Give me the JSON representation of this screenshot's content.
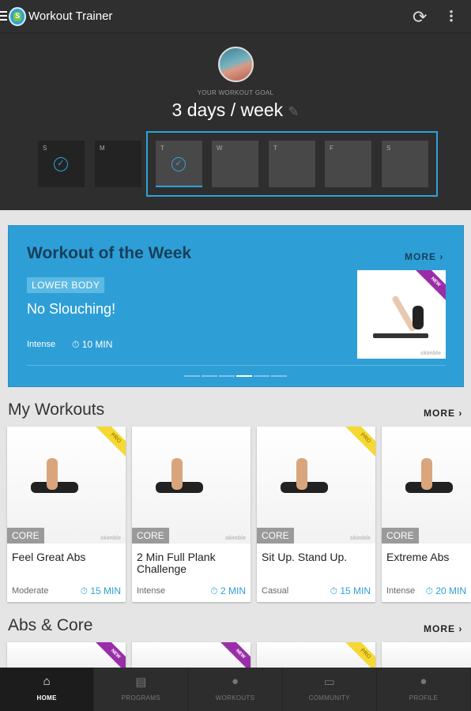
{
  "app": {
    "title": "Workout Trainer",
    "logo_letter": "S"
  },
  "header": {
    "goal_label": "YOUR WORKOUT GOAL",
    "goal": "3 days / week",
    "days": [
      {
        "label": "S",
        "done": true
      },
      {
        "label": "M",
        "done": false
      },
      {
        "label": "T",
        "done": true
      },
      {
        "label": "W",
        "done": false
      },
      {
        "label": "T",
        "done": false
      },
      {
        "label": "F",
        "done": false
      },
      {
        "label": "S",
        "done": false
      }
    ]
  },
  "workout_of_week": {
    "title": "Workout of the Week",
    "more": "MORE",
    "tag": "LOWER BODY",
    "name": "No Slouching!",
    "intensity": "Intense",
    "duration": "10 MIN",
    "badge": "NEW",
    "watermark": "skimble",
    "pages": 6,
    "active_page": 4
  },
  "my_workouts": {
    "title": "My Workouts",
    "more": "MORE",
    "cards": [
      {
        "category": "CORE",
        "name": "Feel Great Abs",
        "intensity": "Moderate",
        "duration": "15 MIN",
        "badge": "PRO",
        "watermark": "skimble"
      },
      {
        "category": "CORE",
        "name": "2 Min Full Plank Challenge",
        "intensity": "Intense",
        "duration": "2 MIN",
        "badge": "",
        "watermark": "skimble"
      },
      {
        "category": "CORE",
        "name": "Sit Up. Stand Up.",
        "intensity": "Casual",
        "duration": "15 MIN",
        "badge": "PRO",
        "watermark": "skimble"
      },
      {
        "category": "CORE",
        "name": "Extreme Abs",
        "intensity": "Intense",
        "duration": "20 MIN",
        "badge": "",
        "watermark": ""
      }
    ]
  },
  "abs_core": {
    "title": "Abs & Core",
    "more": "MORE",
    "badges": [
      "NEW",
      "NEW",
      "PRO",
      ""
    ]
  },
  "nav": [
    {
      "label": "HOME",
      "icon": "home-icon",
      "active": true
    },
    {
      "label": "PROGRAMS",
      "icon": "calendar-icon"
    },
    {
      "label": "WORKOUTS",
      "icon": "stopwatch-icon"
    },
    {
      "label": "COMMUNITY",
      "icon": "chat-icon"
    },
    {
      "label": "PROFILE",
      "icon": "person-icon"
    }
  ],
  "colors": {
    "accent": "#2e9fd6",
    "pro": "#f5d833",
    "new": "#9a2ea8"
  }
}
